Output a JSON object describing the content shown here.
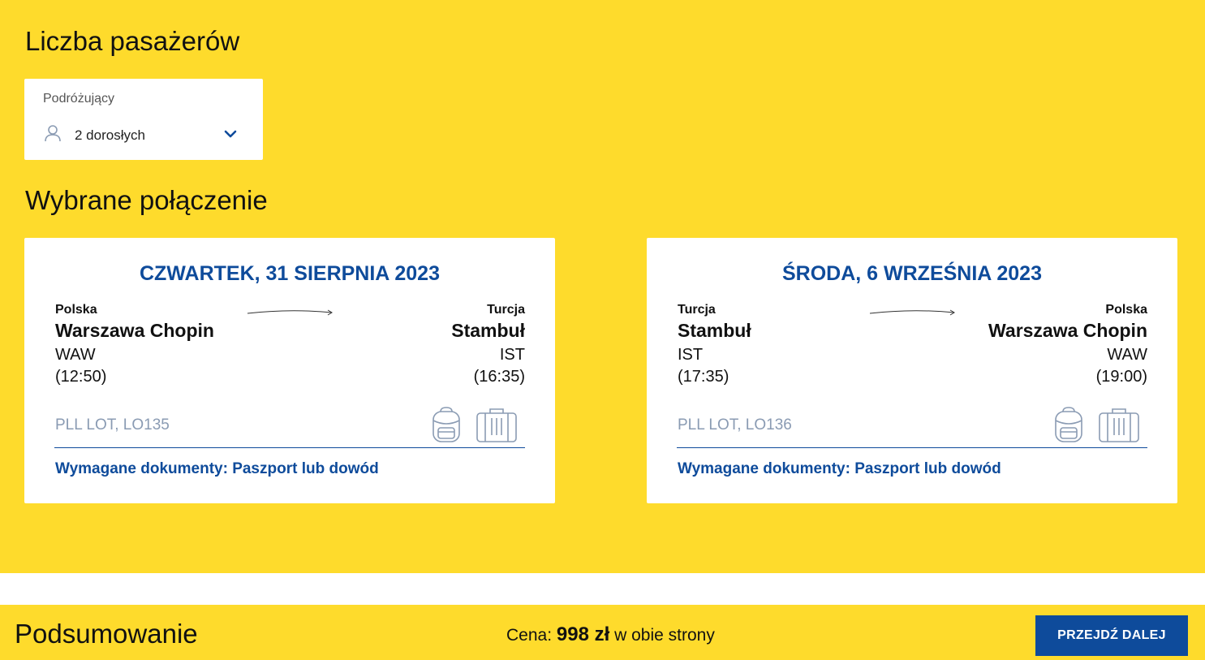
{
  "passengers": {
    "heading": "Liczba pasażerów",
    "field_label": "Podróżujący",
    "value": "2 dorosłych",
    "icons": {
      "user": "user-icon",
      "toggle": "chevron-down-icon"
    }
  },
  "connection": {
    "heading": "Wybrane połączenie",
    "flights": [
      {
        "date": "CZWARTEK, 31 SIERPNIA 2023",
        "origin": {
          "country": "Polska",
          "airport": "Warszawa Chopin",
          "code": "WAW",
          "time": "(12:50)"
        },
        "destination": {
          "country": "Turcja",
          "airport": "Stambuł",
          "code": "IST",
          "time": "(16:35)"
        },
        "flight_info": "PLL LOT, LO135",
        "documents": "Wymagane dokumenty: Paszport lub dowód"
      },
      {
        "date": "ŚRODA, 6 WRZEŚNIA 2023",
        "origin": {
          "country": "Turcja",
          "airport": "Stambuł",
          "code": "IST",
          "time": "(17:35)"
        },
        "destination": {
          "country": "Polska",
          "airport": "Warszawa Chopin",
          "code": "WAW",
          "time": "(19:00)"
        },
        "flight_info": "PLL LOT, LO136",
        "documents": "Wymagane dokumenty: Paszport lub dowód"
      }
    ],
    "icons": {
      "arrow": "arrow-right-icon",
      "backpack": "backpack-icon",
      "suitcase": "suitcase-icon"
    }
  },
  "summary": {
    "title": "Podsumowanie",
    "price_prefix": "Cena: ",
    "price_amount": "998 zł",
    "price_suffix": " w obie strony",
    "next_button": "PRZEJDŹ DALEJ"
  },
  "colors": {
    "background": "#fedb2c",
    "primary": "#0e4b9b",
    "muted": "#8a9bb3",
    "card": "#ffffff"
  }
}
